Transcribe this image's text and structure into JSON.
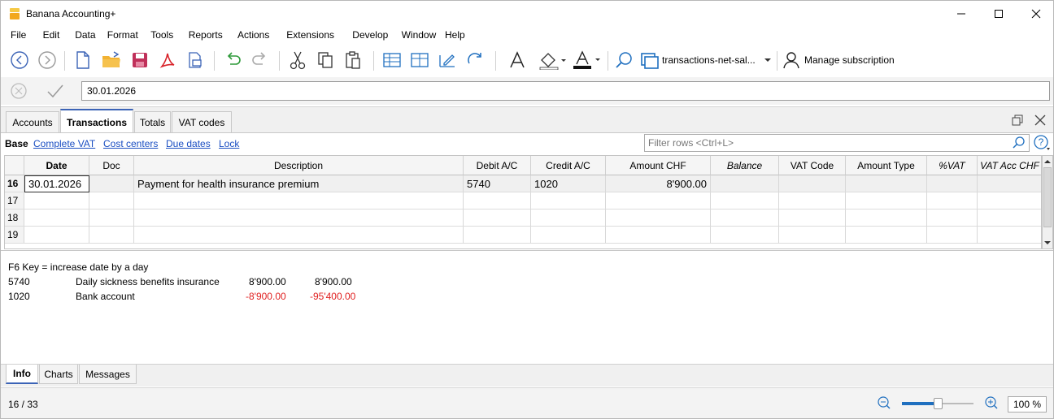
{
  "app": {
    "title": "Banana Accounting+"
  },
  "menu": [
    "File",
    "Edit",
    "Data",
    "Format",
    "Tools",
    "Reports",
    "Actions",
    "Extensions",
    "Develop",
    "Window",
    "Help"
  ],
  "menu_underline": [
    "F",
    "E",
    "D",
    "o",
    "T",
    "R",
    "A",
    "x",
    "v",
    "W",
    "H"
  ],
  "toolbar": {
    "file_dropdown_label": "transactions-net-sal...",
    "subscription_label": "Manage subscription"
  },
  "cellbar": {
    "value": "30.01.2026"
  },
  "tabs": [
    "Accounts",
    "Transactions",
    "Totals",
    "VAT codes"
  ],
  "active_tab": "Transactions",
  "views": {
    "base": "Base",
    "items": [
      "Complete VAT",
      "Cost centers",
      "Due dates",
      "Lock"
    ]
  },
  "filter": {
    "placeholder": "Filter rows <Ctrl+L>"
  },
  "grid": {
    "columns": [
      "Date",
      "Doc",
      "Description",
      "Debit A/C",
      "Credit A/C",
      "Amount CHF",
      "Balance",
      "VAT Code",
      "Amount Type",
      "%VAT",
      "VAT Acc CHF"
    ],
    "rows": [
      {
        "num": "16",
        "date": "30.01.2026",
        "doc": "",
        "description": "Payment for health insurance premium",
        "debit": "5740",
        "credit": "1020",
        "amount": "8'900.00",
        "balance": "",
        "vat_code": "",
        "amount_type": "",
        "vat_pct": "",
        "vat_acc": ""
      },
      {
        "num": "17",
        "date": "",
        "doc": "",
        "description": "",
        "debit": "",
        "credit": "",
        "amount": "",
        "balance": "",
        "vat_code": "",
        "amount_type": "",
        "vat_pct": "",
        "vat_acc": ""
      },
      {
        "num": "18",
        "date": "",
        "doc": "",
        "description": "",
        "debit": "",
        "credit": "",
        "amount": "",
        "balance": "",
        "vat_code": "",
        "amount_type": "",
        "vat_pct": "",
        "vat_acc": ""
      },
      {
        "num": "19",
        "date": "",
        "doc": "",
        "description": "",
        "debit": "",
        "credit": "",
        "amount": "",
        "balance": "",
        "vat_code": "",
        "amount_type": "",
        "vat_pct": "",
        "vat_acc": ""
      }
    ]
  },
  "info": {
    "hint": "F6 Key = increase date by a day",
    "lines": [
      {
        "account": "5740",
        "name": "Daily sickness benefits insurance",
        "amount": "8'900.00",
        "balance": "8'900.00",
        "negative": false
      },
      {
        "account": "1020",
        "name": "Bank account",
        "amount": "-8'900.00",
        "balance": "-95'400.00",
        "negative": true
      }
    ]
  },
  "bottom_tabs": [
    "Info",
    "Charts",
    "Messages"
  ],
  "status": {
    "position": "16 / 33",
    "zoom": "100 %",
    "zoom_level": 0.5
  },
  "colors": {
    "accent": "#3b63b6",
    "negative": "#e02020",
    "link": "#1a4ec2",
    "pdf": "#d8232a",
    "save": "#c0305a",
    "folder": "#f2b233",
    "calc": "#1f6fbf"
  }
}
